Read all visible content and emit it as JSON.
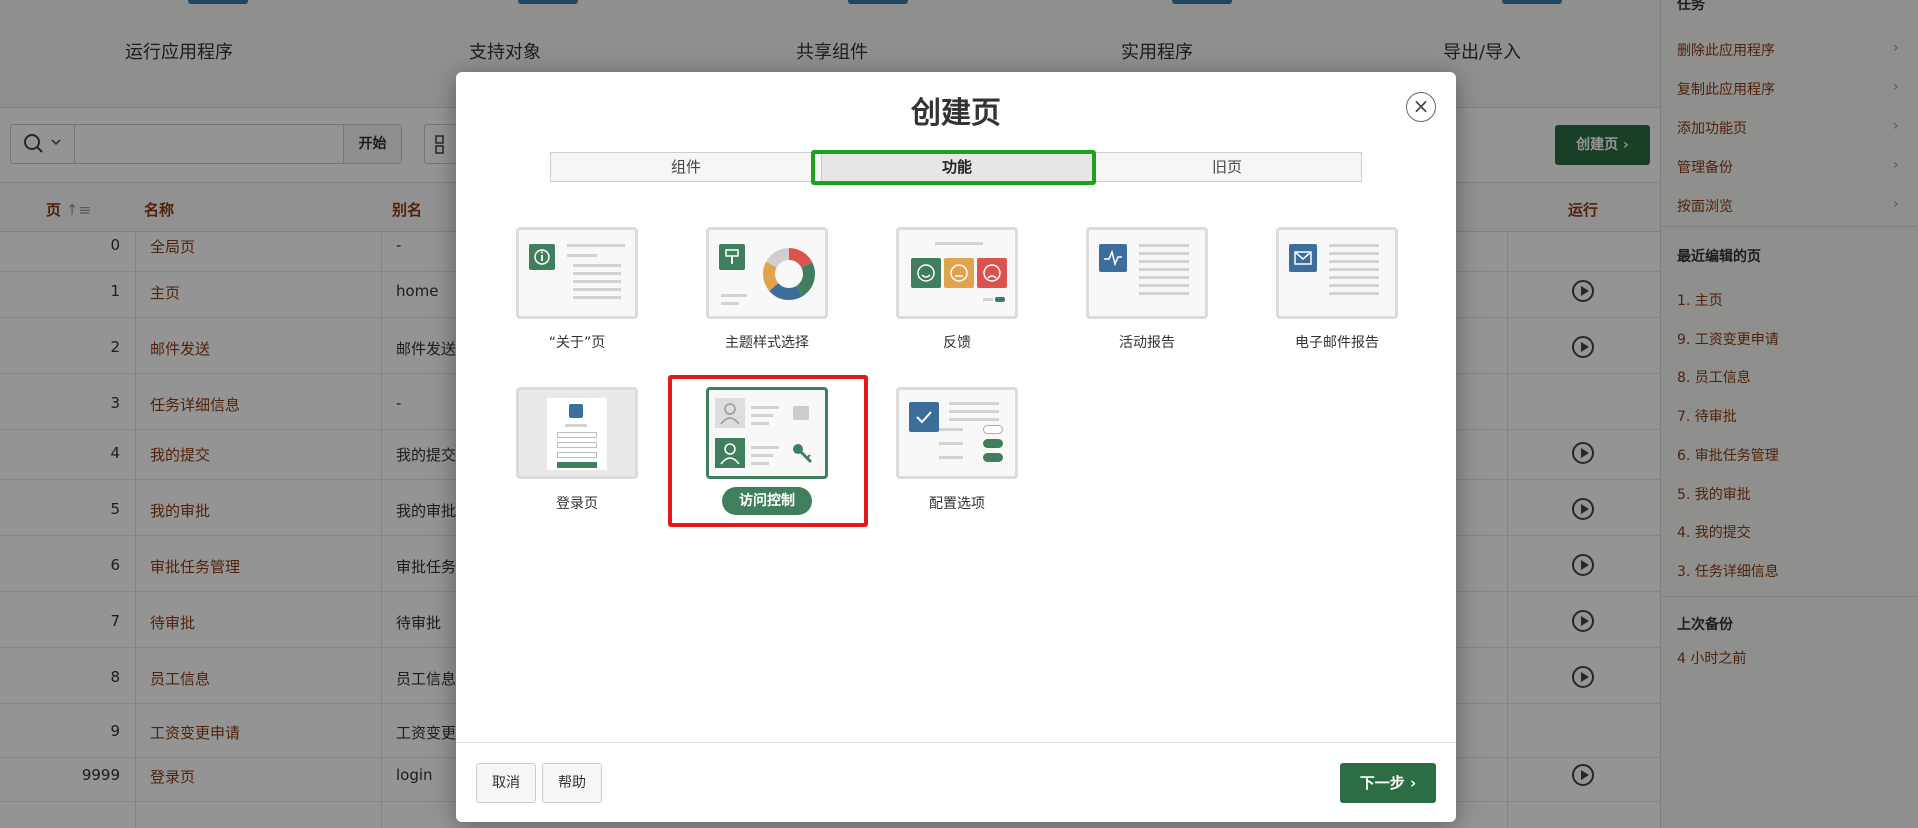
{
  "top_nav": {
    "items": [
      "运行应用程序",
      "支持对象",
      "共享组件",
      "实用程序",
      "导出/导入"
    ]
  },
  "toolbar": {
    "search_value": "",
    "start_label": "开始",
    "create_page_label": "创建页"
  },
  "table": {
    "headers": {
      "page": "页",
      "name": "名称",
      "alias": "别名",
      "run": "运行"
    },
    "rows": [
      {
        "num": "0",
        "name": "全局页",
        "alias": "-",
        "run": false
      },
      {
        "num": "1",
        "name": "主页",
        "alias": "home",
        "run": true
      },
      {
        "num": "2",
        "name": "邮件发送",
        "alias": "邮件发送",
        "run": true
      },
      {
        "num": "3",
        "name": "任务详细信息",
        "alias": "-",
        "run": false
      },
      {
        "num": "4",
        "name": "我的提交",
        "alias": "我的提交",
        "run": true
      },
      {
        "num": "5",
        "name": "我的审批",
        "alias": "我的审批",
        "run": true
      },
      {
        "num": "6",
        "name": "审批任务管理",
        "alias": "审批任务",
        "run": true
      },
      {
        "num": "7",
        "name": "待审批",
        "alias": "待审批",
        "run": true
      },
      {
        "num": "8",
        "name": "员工信息",
        "alias": "员工信息",
        "run": true
      },
      {
        "num": "9",
        "name": "工资变更申请",
        "alias": "工资变更",
        "run": false
      },
      {
        "num": "9999",
        "name": "登录页",
        "alias": "login",
        "run": true
      }
    ]
  },
  "sidebar": {
    "tasks_title": "任务",
    "tasks": [
      "删除此应用程序",
      "复制此应用程序",
      "添加功能页",
      "管理备份",
      "按面浏览"
    ],
    "recent_title": "最近编辑的页",
    "recent": [
      "1. 主页",
      "9. 工资变更申请",
      "8. 员工信息",
      "7. 待审批",
      "6. 审批任务管理",
      "5. 我的审批",
      "4. 我的提交",
      "3. 任务详细信息"
    ],
    "backup_title": "上次备份",
    "backup_value": "4 小时之前"
  },
  "dialog": {
    "title": "创建页",
    "close": "×",
    "tabs": [
      {
        "label": "组件",
        "active": false
      },
      {
        "label": "功能",
        "active": true
      },
      {
        "label": "旧页",
        "active": false
      }
    ],
    "cards": [
      {
        "label": "“关于”页",
        "icon": "info-icon",
        "selected": false
      },
      {
        "label": "主题样式选择",
        "icon": "paint-roller-icon",
        "selected": false
      },
      {
        "label": "反馈",
        "icon": "smiley-faces-icon",
        "selected": false
      },
      {
        "label": "活动报告",
        "icon": "activity-pulse-icon",
        "selected": false
      },
      {
        "label": "电子邮件报告",
        "icon": "envelope-icon",
        "selected": false
      },
      {
        "label": "登录页",
        "icon": "login-form-icon",
        "selected": false
      },
      {
        "label": "访问控制",
        "icon": "access-control-icon",
        "selected": true
      },
      {
        "label": "配置选项",
        "icon": "checkbox-toggles-icon",
        "selected": false
      }
    ],
    "cancel_label": "取消",
    "help_label": "帮助",
    "next_label": "下一步"
  },
  "colors": {
    "accent_green": "#3f7f5e",
    "button_green": "#2d6d44",
    "link_brown": "#8a3c13",
    "tab_highlight": "#1ea11e",
    "selection_highlight": "#e21a1a",
    "arrow_green": "#1ea11e"
  }
}
